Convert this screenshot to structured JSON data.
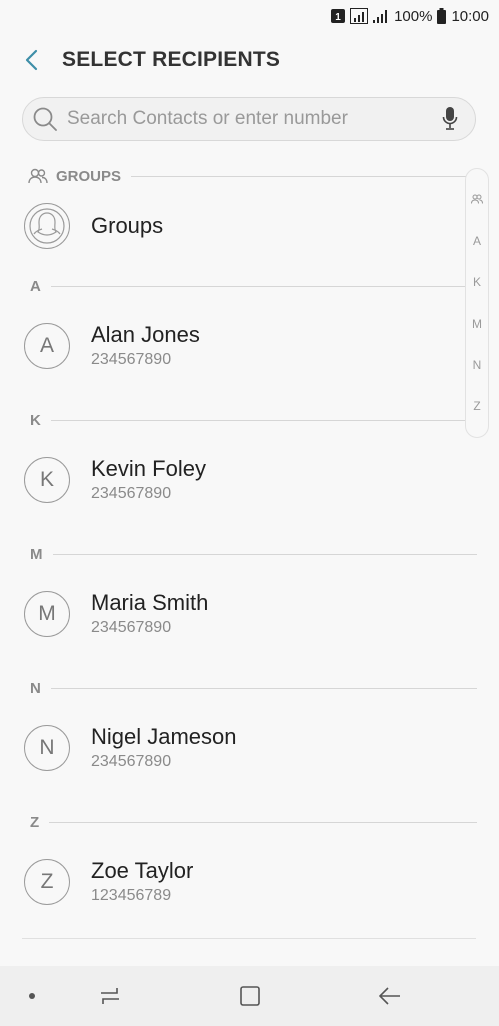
{
  "status_bar": {
    "sim_label": "1",
    "battery": "100%",
    "time": "10:00"
  },
  "header": {
    "title": "SELECT RECIPIENTS"
  },
  "search": {
    "placeholder": "Search Contacts or enter number",
    "value": ""
  },
  "groups": {
    "section_label": "GROUPS",
    "item_label": "Groups"
  },
  "contacts": [
    {
      "section": "A",
      "initial": "A",
      "name": "Alan Jones",
      "number": "234567890"
    },
    {
      "section": "K",
      "initial": "K",
      "name": "Kevin Foley",
      "number": "234567890"
    },
    {
      "section": "M",
      "initial": "M",
      "name": "Maria Smith",
      "number": "234567890"
    },
    {
      "section": "N",
      "initial": "N",
      "name": "Nigel Jameson",
      "number": "234567890"
    },
    {
      "section": "Z",
      "initial": "Z",
      "name": "Zoe Taylor",
      "number": "123456789"
    }
  ],
  "index_scroller": [
    "A",
    "K",
    "M",
    "N",
    "Z"
  ],
  "icons": {
    "back": "chevron-left-icon",
    "search": "search-icon",
    "mic": "mic-icon",
    "groups": "groups-icon",
    "recents": "recents-icon",
    "home": "home-icon",
    "nav_back": "back-arrow-icon"
  },
  "colors": {
    "accent": "#3e8fa8",
    "background": "#f8f8f8",
    "muted_text": "#8a8a8a"
  }
}
